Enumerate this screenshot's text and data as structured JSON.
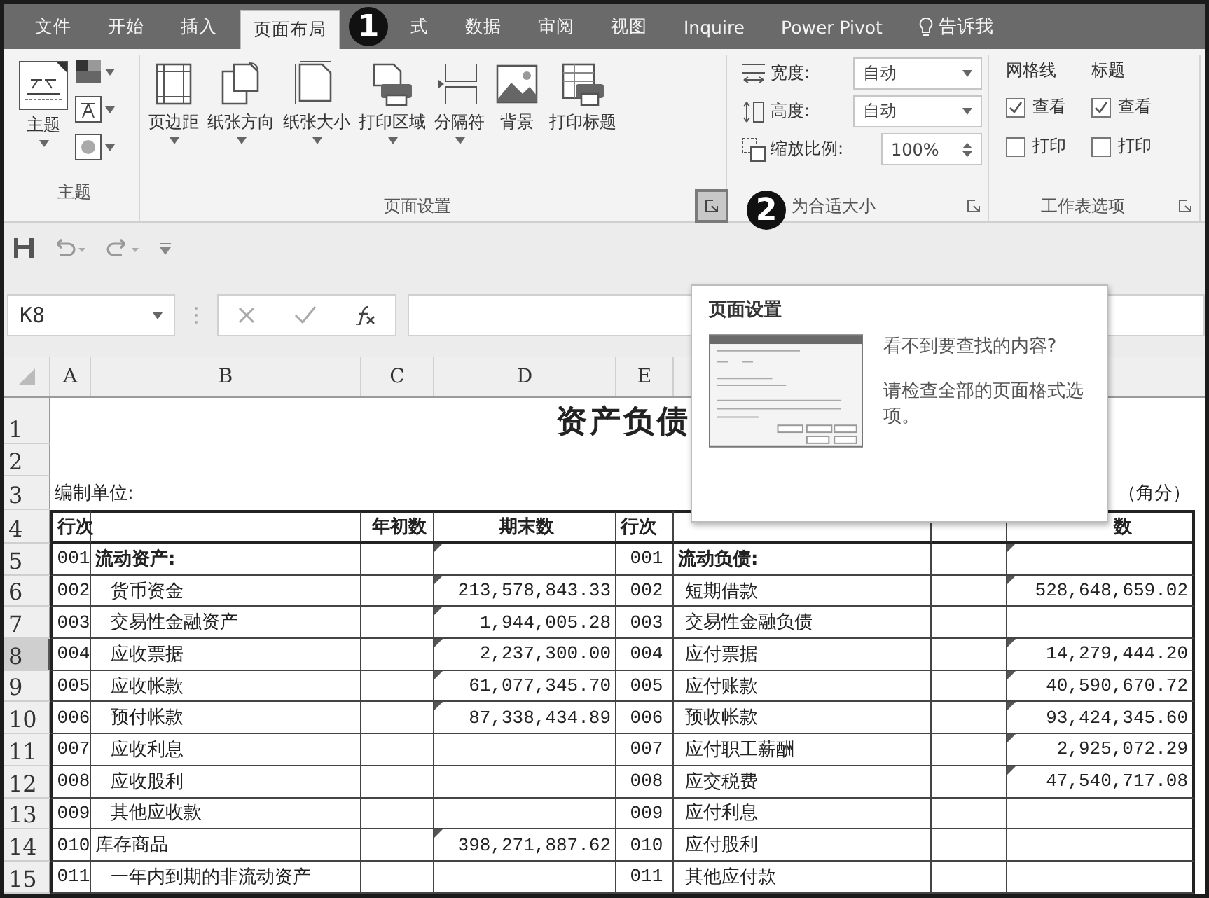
{
  "tabs": [
    {
      "label": "文件",
      "selected": false
    },
    {
      "label": "开始",
      "selected": false
    },
    {
      "label": "插入",
      "selected": false
    },
    {
      "label": "页面布局",
      "selected": true
    },
    {
      "label": "式",
      "selected": false
    },
    {
      "label": "数据",
      "selected": false
    },
    {
      "label": "审阅",
      "selected": false
    },
    {
      "label": "视图",
      "selected": false
    },
    {
      "label": "Inquire",
      "selected": false
    },
    {
      "label": "Power Pivot",
      "selected": false
    }
  ],
  "tell_me": "告诉我",
  "callouts": [
    "1",
    "2"
  ],
  "theme_group": {
    "label": "主题",
    "button": "主题"
  },
  "page_setup_group": {
    "label": "页面设置",
    "buttons": [
      "页边距",
      "纸张方向",
      "纸张大小",
      "打印区域",
      "分隔符",
      "背景",
      "打印标题"
    ]
  },
  "scale_group": {
    "label": "为合适大小",
    "fields": [
      {
        "label": "宽度:",
        "value": "自动",
        "kind": "dropdown"
      },
      {
        "label": "高度:",
        "value": "自动",
        "kind": "dropdown"
      },
      {
        "label": "缩放比例:",
        "value": "100%",
        "kind": "spinner"
      }
    ]
  },
  "sheet_options": {
    "label": "工作表选项",
    "columns": [
      {
        "title": "网格线",
        "options": [
          {
            "label": "查看",
            "checked": true
          },
          {
            "label": "打印",
            "checked": false
          }
        ]
      },
      {
        "title": "标题",
        "options": [
          {
            "label": "查看",
            "checked": true
          },
          {
            "label": "打印",
            "checked": false
          }
        ]
      }
    ]
  },
  "formula_bar": {
    "name_box": "K8"
  },
  "columns": [
    "A",
    "B",
    "C",
    "D",
    "E"
  ],
  "sheet": {
    "rows": [
      {
        "num": "1",
        "kind": "title",
        "selected": false,
        "title": "资产负债"
      },
      {
        "num": "2",
        "kind": "blank",
        "selected": false
      },
      {
        "num": "3",
        "kind": "unit",
        "selected": false,
        "a": "编制单位:",
        "h": "（角分）"
      },
      {
        "num": "4",
        "kind": "header",
        "selected": false,
        "a": "行次",
        "c": "年初数",
        "d": "期末数",
        "e": "行次",
        "h": "数"
      },
      {
        "num": "5",
        "kind": "section",
        "selected": false,
        "a": "001",
        "b": "流动资产:",
        "d_flag": true,
        "e": "001",
        "f": "流动负债:",
        "h_flag": true
      },
      {
        "num": "6",
        "kind": "item",
        "selected": false,
        "a": "002",
        "b": "货币资金",
        "d": "213,578,843.33",
        "d_flag": true,
        "e": "002",
        "f": "短期借款",
        "h": "528,648,659.02",
        "h_flag": true
      },
      {
        "num": "7",
        "kind": "item",
        "selected": false,
        "a": "003",
        "b": "交易性金融资产",
        "d": "1,944,005.28",
        "d_flag": true,
        "e": "003",
        "f": "交易性金融负债"
      },
      {
        "num": "8",
        "kind": "item",
        "selected": true,
        "a": "004",
        "b": "应收票据",
        "d": "2,237,300.00",
        "d_flag": true,
        "e": "004",
        "f": "应付票据",
        "h": "14,279,444.20",
        "h_flag": true
      },
      {
        "num": "9",
        "kind": "item",
        "selected": false,
        "a": "005",
        "b": "应收帐款",
        "d": "61,077,345.70",
        "d_flag": true,
        "e": "005",
        "f": "应付账款",
        "h": "40,590,670.72",
        "h_flag": true
      },
      {
        "num": "10",
        "kind": "item",
        "selected": false,
        "a": "006",
        "b": "预付帐款",
        "d": "87,338,434.89",
        "d_flag": true,
        "e": "006",
        "f": "预收帐款",
        "h": "93,424,345.60",
        "h_flag": true
      },
      {
        "num": "11",
        "kind": "item",
        "selected": false,
        "a": "007",
        "b": "应收利息",
        "e": "007",
        "f": "应付职工薪酬",
        "h": "2,925,072.29",
        "h_flag": true
      },
      {
        "num": "12",
        "kind": "item",
        "selected": false,
        "a": "008",
        "b": "应收股利",
        "e": "008",
        "f": "应交税费",
        "h": "47,540,717.08",
        "h_flag": true
      },
      {
        "num": "13",
        "kind": "item",
        "selected": false,
        "a": "009",
        "b": "其他应收款",
        "e": "009",
        "f": "应付利息"
      },
      {
        "num": "14",
        "kind": "top",
        "selected": false,
        "a": "010",
        "b": "库存商品",
        "d": "398,271,887.62",
        "d_flag": true,
        "e": "010",
        "f": "应付股利"
      },
      {
        "num": "15",
        "kind": "item",
        "selected": false,
        "a": "011",
        "b": "一年内到期的非流动资产",
        "e": "011",
        "f": "其他应付款"
      }
    ]
  },
  "tooltip": {
    "title": "页面设置",
    "lines": [
      "看不到要查找的内容?",
      "请检查全部的页面格式选项。"
    ]
  }
}
